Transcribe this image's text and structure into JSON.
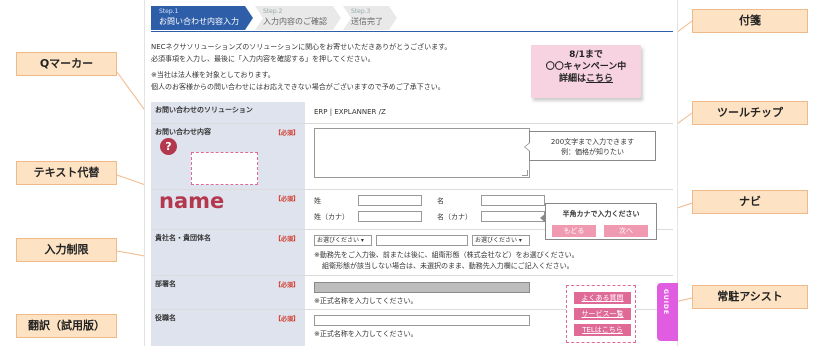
{
  "steps": [
    {
      "num": "Step.1",
      "label": "お問い合わせ内容入力"
    },
    {
      "num": "Step.2",
      "label": "入力内容のご確認"
    },
    {
      "num": "Step.3",
      "label": "送信完了"
    }
  ],
  "intro": {
    "line1": "NECネクサソリューションズのソリューションに関心をお寄せいただきありがとうございます。",
    "line2": "必須事項を入力し、最後に「入力内容を確認する」を押してください。",
    "line3": "※当社は法人様を対象としております。",
    "line4": "個人のお客様からの問い合わせにはお応えできない場合がございますので予めご了承下さい。"
  },
  "form": {
    "required_label": "【必須】",
    "solution_label": "お問い合わせのソリューション",
    "solution_value": "ERP | EXPLANNER /Z",
    "inquiry_label": "お問い合わせ内容",
    "sei": "姓",
    "mei": "名",
    "sei_kana": "姓（カナ）",
    "mei_kana": "名（カナ）",
    "company_label": "貴社名・貴団体名",
    "select_placeholder": "お選びください",
    "company_note1": "※動務先をご入力後、前または後に、組衛形態（株式会社など）をお選びください。",
    "company_note2": "組衛形態が該当しない場合は、未選択のまま、動務先入力欄にご記入ください。",
    "dept_label": "部署名",
    "dept_note": "※正式名称を入力してください。",
    "title_label": "役職名",
    "title_note": "※正式名称を入力してください。"
  },
  "widgets": {
    "qmark": "?",
    "name_text": "name",
    "sticky_line1": "8/1まで",
    "sticky_line2": "〇〇キャンペーン中",
    "sticky_line3": "詳細は",
    "sticky_link": "こちら",
    "tooltip_line1": "200文字まで入力できます",
    "tooltip_line2": "例：価格が知りたい",
    "navi_text": "半角カナで入力ください",
    "navi_back": "もどる",
    "navi_next": "次へ",
    "assist_faq": "よくある質問",
    "assist_services": "サービス一覧",
    "assist_tel": "TELはこちら",
    "guide_tab": "GUIDE"
  },
  "callouts": {
    "q_marker": "Qマーカー",
    "text_alt": "テキスト代替",
    "input_limit": "入力制限",
    "translation": "翻訳（試用版）",
    "sticky": "付箋",
    "tooltip": "ツールチップ",
    "navi": "ナビ",
    "assist": "常駐アシスト"
  },
  "colors": {
    "step_active": "#2f5ea8",
    "label_bg": "#dfe3ee",
    "required": "#d03a2a",
    "callout_bg": "#fde3c4",
    "callout_border": "#f0b98a",
    "accent_pink": "#e06a96",
    "sticky_bg": "#f7d2e0",
    "guide_tab": "#e05ce0"
  }
}
